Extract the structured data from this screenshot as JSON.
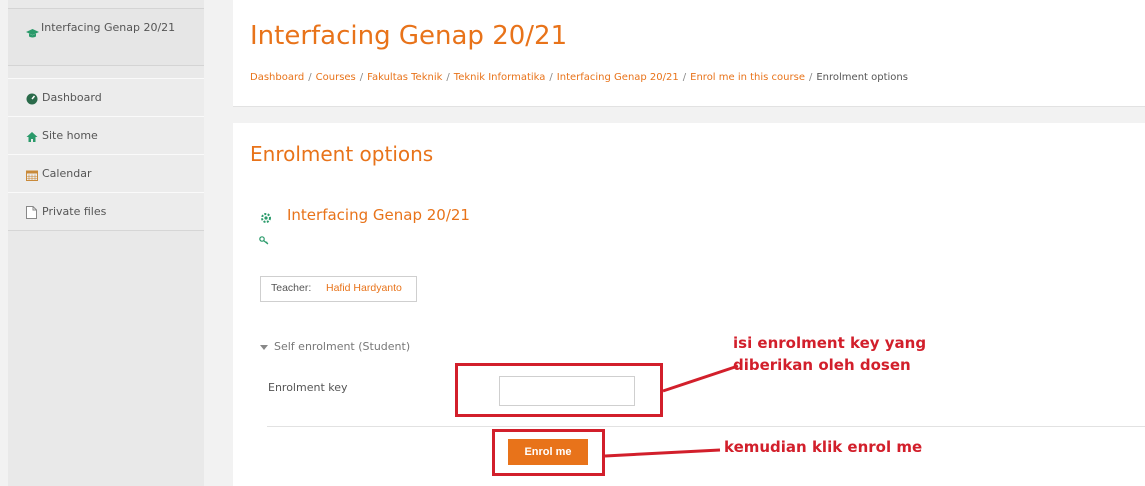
{
  "sidebar": {
    "course": "Interfacing Genap 20/21",
    "items": [
      {
        "label": "Dashboard",
        "icon": "dashboard-icon"
      },
      {
        "label": "Site home",
        "icon": "home-icon"
      },
      {
        "label": "Calendar",
        "icon": "calendar-icon"
      },
      {
        "label": "Private files",
        "icon": "file-icon"
      }
    ]
  },
  "header": {
    "title": "Interfacing Genap 20/21",
    "breadcrumb": [
      "Dashboard",
      "Courses",
      "Fakultas Teknik",
      "Teknik Informatika",
      "Interfacing Genap 20/21",
      "Enrol me in this course",
      "Enrolment options"
    ]
  },
  "main": {
    "section_title": "Enrolment options",
    "course_name": "Interfacing Genap 20/21",
    "teacher_label": "Teacher:",
    "teacher_name": "Hafid Hardyanto",
    "self_enrol": "Self enrolment (Student)",
    "key_label": "Enrolment key",
    "key_value": "",
    "enrol_button": "Enrol me"
  },
  "annotations": {
    "note1_line1": "isi enrolment key yang",
    "note1_line2": "diberikan oleh dosen",
    "note2": "kemudian klik enrol me"
  },
  "colors": {
    "accent": "#e8731a",
    "annotation": "#d21f2b"
  }
}
